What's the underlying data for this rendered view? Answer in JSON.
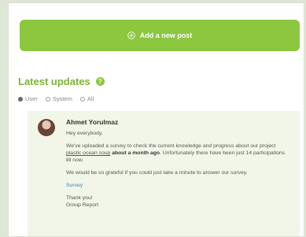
{
  "add_post": {
    "label": "Add a new post",
    "icon": "plus-circle-icon"
  },
  "updates": {
    "title": "Latest updates",
    "help_icon": "help-icon",
    "filters": [
      {
        "label": "User",
        "selected": true
      },
      {
        "label": "System",
        "selected": false
      },
      {
        "label": "All",
        "selected": false
      }
    ]
  },
  "post": {
    "author": "Ahmet Yorulmaz",
    "greeting": "Hey everybody,",
    "p1_before": "We've uploaded a survey to check the current knowledge and progress about our project ",
    "p1_link": "plastic ocean soup",
    "p1_bold": "about a month ago",
    "p1_after": ". Unfortunately there have been just 14 participations till now.",
    "p2": "We would be so grateful if you could just take a minute to answer our survey.",
    "survey_link": "Survey",
    "closing_1": "Thank you!",
    "closing_2": "Group Report"
  },
  "colors": {
    "accent": "#8dc63f",
    "title": "#7db23a",
    "link": "#3f7fc0"
  }
}
